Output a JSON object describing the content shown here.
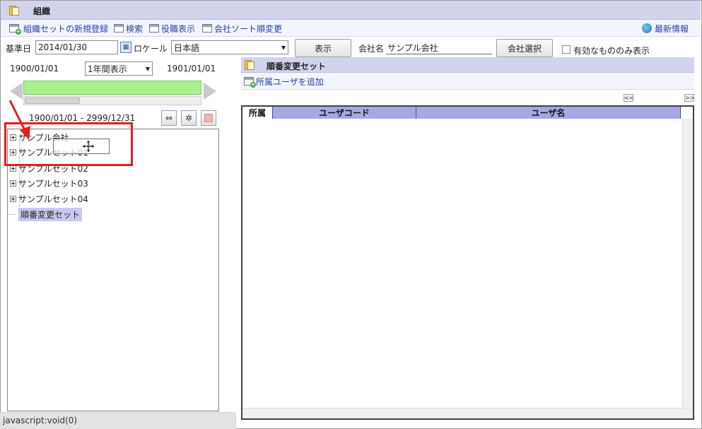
{
  "header": {
    "title": "組織"
  },
  "actions": {
    "new_set": "組織セットの新規登録",
    "search": "検索",
    "position_view": "役職表示",
    "company_sort": "会社ソート順変更",
    "latest_info": "最新情報"
  },
  "form": {
    "base_date_label": "基準日",
    "base_date_value": "2014/01/30",
    "locale_label": "ロケール",
    "locale_value": "日本語",
    "show_button": "表示",
    "company_label": "会社名",
    "company_value": "サンプル会社",
    "company_select_button": "会社選択",
    "valid_only_label": "有効なもののみ表示"
  },
  "timeline": {
    "start": "1900/01/01",
    "end": "1901/01/01",
    "period_select": "1年間表示",
    "range": "1900/01/01 - 2999/12/31"
  },
  "tree": {
    "items": [
      {
        "label": "サンプル会社"
      },
      {
        "label": "サンプルセット01"
      },
      {
        "label": "サンプルセット02"
      },
      {
        "label": "サンプルセット03"
      },
      {
        "label": "サンプルセット04"
      },
      {
        "label": "順番変更セット"
      }
    ]
  },
  "right_panel": {
    "title": "順番変更セット",
    "add_user": "所属ユーザを追加",
    "pager_prev": "<<",
    "pager_next": ">>",
    "columns": [
      "所属",
      "ユーザコード",
      "ユーザ名"
    ]
  },
  "status": {
    "text": "javascript:void(0)"
  },
  "colors": {
    "header_bg": "#d2d4ee",
    "link": "#1f3fa8",
    "timeline_fill": "#a9f08f",
    "highlight": "#e02020"
  }
}
